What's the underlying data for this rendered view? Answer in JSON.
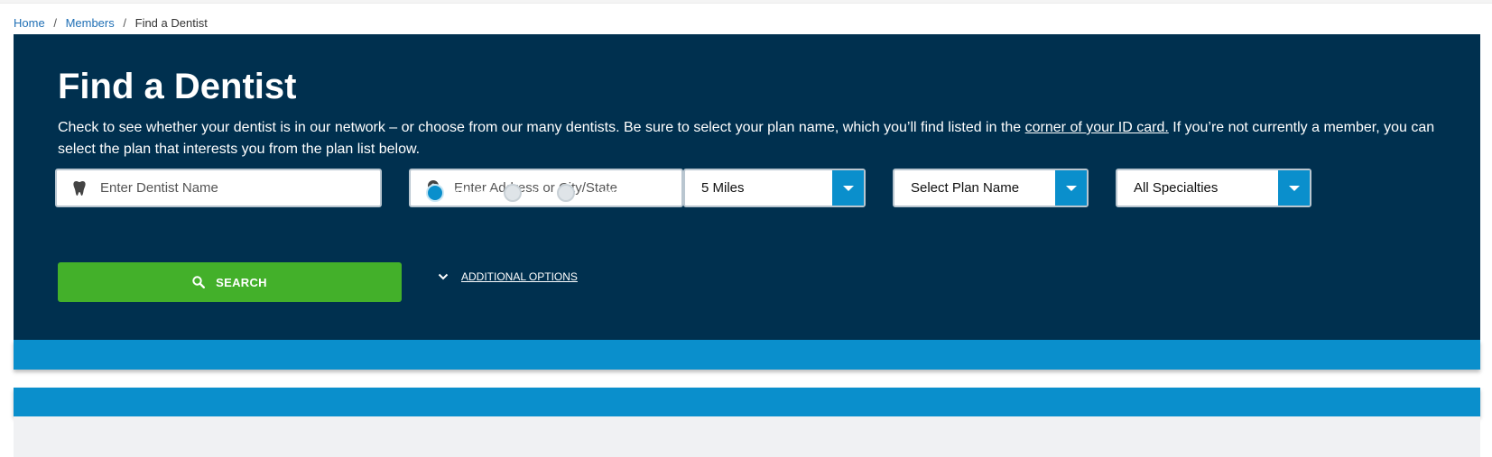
{
  "breadcrumb": {
    "items": [
      "Home",
      "Members",
      "Find a Dentist"
    ],
    "separator": "/"
  },
  "hero": {
    "title": "Find a Dentist",
    "desc_part1": "Check to see whether your dentist is in our network – or choose from our many dentists. Be sure to select your plan name, which you’ll find listed in the ",
    "desc_link": "corner of your ID card.",
    "desc_part2": " If you’re not currently a member, you can select the plan that interests you from the plan list below."
  },
  "form": {
    "dentist_name_placeholder": "Enter Dentist Name",
    "address_placeholder": "Enter Address or City/State",
    "distance_value": "5 Miles",
    "plan_placeholder": "Select Plan Name",
    "specialty_value": "All Specialties",
    "radios": [
      {
        "label": "Address",
        "selected": true
      },
      {
        "label": "Zip",
        "selected": false
      },
      {
        "label": "County",
        "selected": false
      }
    ],
    "search_label": "SEARCH",
    "additional_options_label": "ADDITIONAL OPTIONS"
  },
  "icons": {
    "dentist_field": "tooth-icon",
    "address_field": "map-pin-icon",
    "search_button": "search-icon",
    "additional_options": "chevron-down-icon",
    "dropdowns": "caret-down-icon"
  },
  "colors": {
    "hero_bg": "#00304f",
    "accent_blue": "#0a8fcc",
    "search_green": "#43b02a",
    "link_blue": "#1f6fb5"
  }
}
